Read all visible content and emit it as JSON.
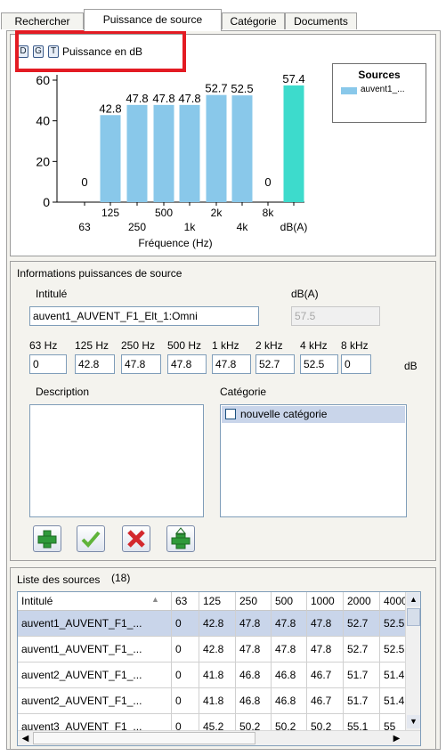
{
  "tabs": [
    "Rechercher",
    "Puissance de source",
    "Catégorie",
    "Documents"
  ],
  "chart_toolbar": {
    "buttons": [
      "D",
      "G",
      "T"
    ],
    "label": "Puissance en dB"
  },
  "legend": {
    "title": "Sources",
    "entries": [
      {
        "label": "auvent1_...",
        "color": "#89c8ea"
      }
    ]
  },
  "chart_data": {
    "type": "bar",
    "xlabel": "Fréquence (Hz)",
    "ylabel": "",
    "ylim": [
      0,
      60
    ],
    "yticks": [
      0,
      20,
      40,
      60
    ],
    "categories": [
      "63",
      "125",
      "250",
      "500",
      "1k",
      "2k",
      "4k",
      "8k",
      "dB(A)"
    ],
    "values": [
      0,
      42.8,
      47.8,
      47.8,
      47.8,
      52.7,
      52.5,
      0,
      57.4
    ],
    "value_labels": [
      "0",
      "42.8",
      "47.8",
      "47.8",
      "47.8",
      "52.7",
      "52.5",
      "0",
      "57.4"
    ],
    "series_color": "#89c8ea",
    "total_color": "#3ddbcc",
    "grid": false
  },
  "info": {
    "group_title": "Informations puissances de source",
    "intitule_label": "Intitulé",
    "intitule_value": "auvent1_AUVENT_F1_Elt_1:Omni",
    "dba_label": "dB(A)",
    "dba_value": "57.5",
    "band_labels": [
      "63 Hz",
      "125 Hz",
      "250 Hz",
      "500 Hz",
      "1 kHz",
      "2 kHz",
      "4 kHz",
      "8 kHz"
    ],
    "band_values": [
      "0",
      "42.8",
      "47.8",
      "47.8",
      "47.8",
      "52.7",
      "52.5",
      "0"
    ],
    "unit": "dB",
    "description_label": "Description",
    "description_value": "",
    "categorie_label": "Catégorie",
    "categories": [
      {
        "label": "nouvelle catégorie",
        "checked": false
      }
    ]
  },
  "actions": [
    "add-icon",
    "check-icon",
    "delete-icon",
    "upload-icon"
  ],
  "sources": {
    "group_title": "Liste des sources",
    "count": "(18)",
    "columns": [
      "Intitulé",
      "63",
      "125",
      "250",
      "500",
      "1000",
      "2000",
      "4000"
    ],
    "rows": [
      [
        "auvent1_AUVENT_F1_...",
        "0",
        "42.8",
        "47.8",
        "47.8",
        "47.8",
        "52.7",
        "52.5"
      ],
      [
        "auvent1_AUVENT_F1_...",
        "0",
        "42.8",
        "47.8",
        "47.8",
        "47.8",
        "52.7",
        "52.5"
      ],
      [
        "auvent2_AUVENT_F1_...",
        "0",
        "41.8",
        "46.8",
        "46.8",
        "46.7",
        "51.7",
        "51.4"
      ],
      [
        "auvent2_AUVENT_F1_...",
        "0",
        "41.8",
        "46.8",
        "46.8",
        "46.7",
        "51.7",
        "51.4"
      ],
      [
        "auvent3_AUVENT_F1_...",
        "0",
        "45.2",
        "50.2",
        "50.2",
        "50.2",
        "55.1",
        "55"
      ]
    ],
    "selected_row": 0
  }
}
